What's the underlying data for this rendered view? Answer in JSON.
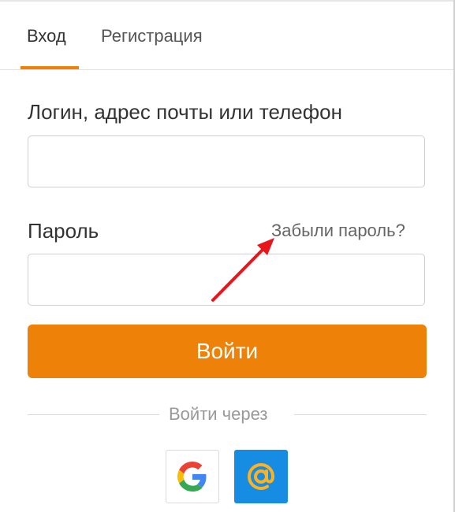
{
  "tabs": {
    "login_label": "Вход",
    "register_label": "Регистрация"
  },
  "form": {
    "login_label": "Логин, адрес почты или телефон",
    "login_value": "",
    "login_placeholder": "",
    "password_label": "Пароль",
    "password_value": "",
    "password_placeholder": "",
    "forgot_link": "Забыли пароль?",
    "submit_label": "Войти"
  },
  "social": {
    "divider_text": "Войти через",
    "providers": [
      {
        "name": "google-icon"
      },
      {
        "name": "mail-ru-at-icon"
      }
    ]
  },
  "colors": {
    "accent": "#ee8208",
    "mail_blue": "#168de2",
    "annotation_arrow": "#e8151b"
  }
}
